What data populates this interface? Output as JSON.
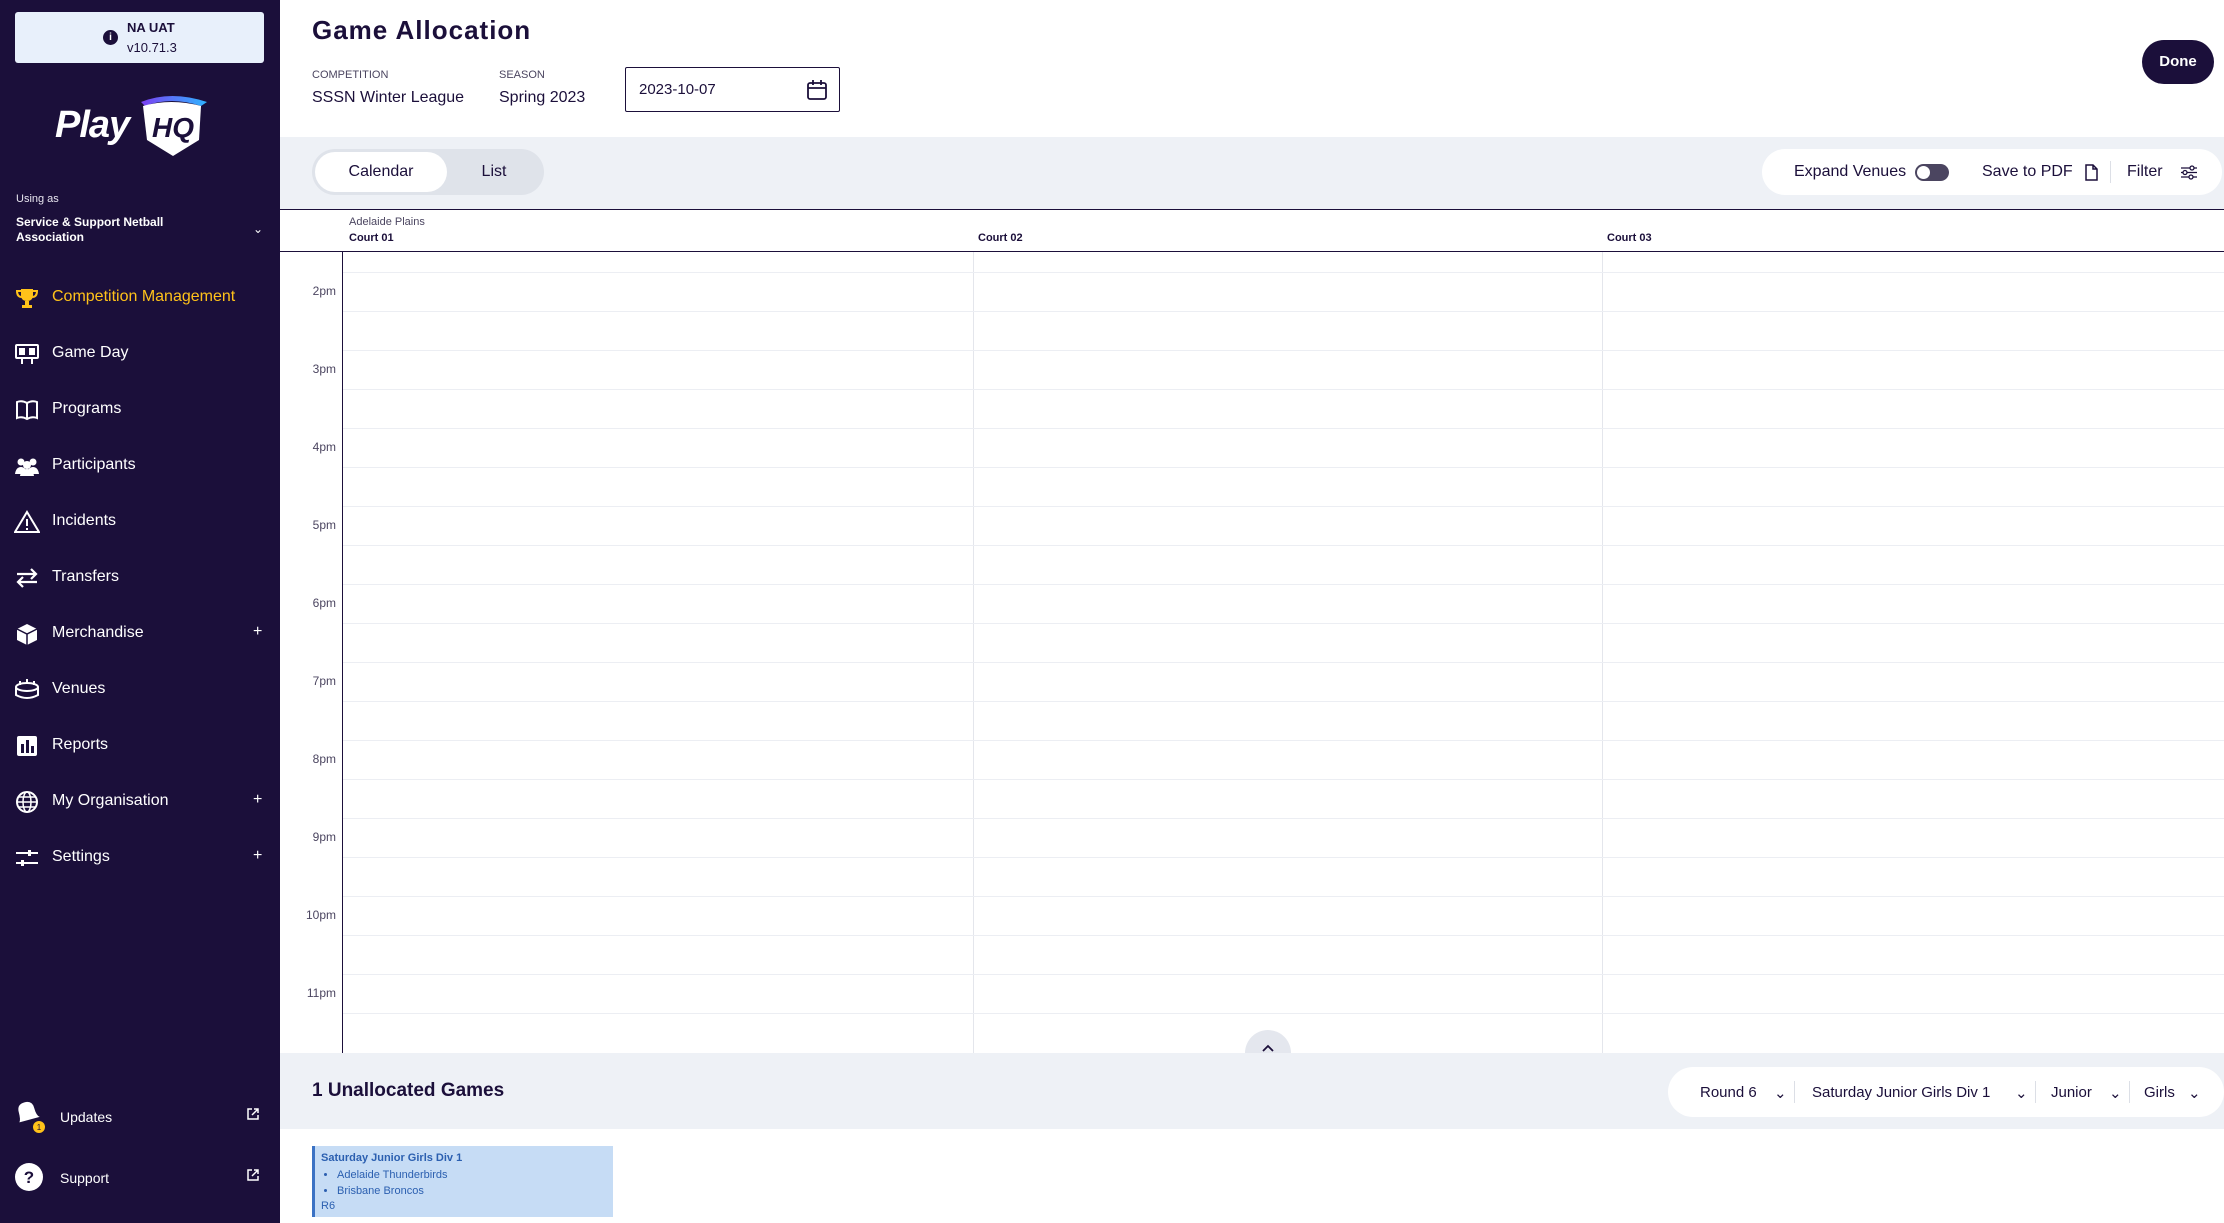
{
  "env": {
    "name": "NA UAT",
    "version": "v10.71.3"
  },
  "brand": {
    "logo_text_play": "Play",
    "logo_text_hq": "HQ"
  },
  "org": {
    "using_as": "Using as",
    "name": "Service & Support Netball Association"
  },
  "nav": {
    "items": [
      {
        "label": "Competition Management",
        "icon": "trophy-icon",
        "active": true
      },
      {
        "label": "Game Day",
        "icon": "scoreboard-icon"
      },
      {
        "label": "Programs",
        "icon": "book-icon"
      },
      {
        "label": "Participants",
        "icon": "people-icon"
      },
      {
        "label": "Incidents",
        "icon": "warning-icon"
      },
      {
        "label": "Transfers",
        "icon": "transfer-icon"
      },
      {
        "label": "Merchandise",
        "icon": "box-icon",
        "expand": "+"
      },
      {
        "label": "Venues",
        "icon": "stadium-icon"
      },
      {
        "label": "Reports",
        "icon": "chart-icon"
      },
      {
        "label": "My Organisation",
        "icon": "globe-icon",
        "expand": "+"
      },
      {
        "label": "Settings",
        "icon": "sliders-icon",
        "expand": "+"
      }
    ],
    "bottom": [
      {
        "label": "Updates",
        "icon": "bell-icon"
      },
      {
        "label": "Support",
        "icon": "help-icon"
      }
    ]
  },
  "header": {
    "title": "Game Allocation",
    "competition_label": "COMPETITION",
    "competition_value": "SSSN Winter League",
    "season_label": "SEASON",
    "season_value": "Spring 2023",
    "date": "2023-10-07",
    "done_label": "Done"
  },
  "toolbar": {
    "tabs": {
      "calendar": "Calendar",
      "list": "List"
    },
    "expand_venues": "Expand Venues",
    "save_pdf": "Save to PDF",
    "filter": "Filter"
  },
  "calendar": {
    "venue": "Adelaide Plains",
    "courts": [
      "Court 01",
      "Court 02",
      "Court 03"
    ],
    "times": [
      "2pm",
      "3pm",
      "4pm",
      "5pm",
      "6pm",
      "7pm",
      "8pm",
      "9pm",
      "10pm",
      "11pm"
    ]
  },
  "unallocated": {
    "title": "1 Unallocated Games",
    "filters": [
      "Round 6",
      "Saturday Junior Girls Div 1",
      "Junior",
      "Girls"
    ],
    "game": {
      "division": "Saturday Junior Girls Div 1",
      "teams": [
        "Adelaide Thunderbirds",
        "Brisbane Broncos"
      ],
      "round": "R6"
    }
  },
  "colors": {
    "sidebar": "#1b0f3a",
    "active": "#ffc21a",
    "card": "#c6dcf5"
  }
}
